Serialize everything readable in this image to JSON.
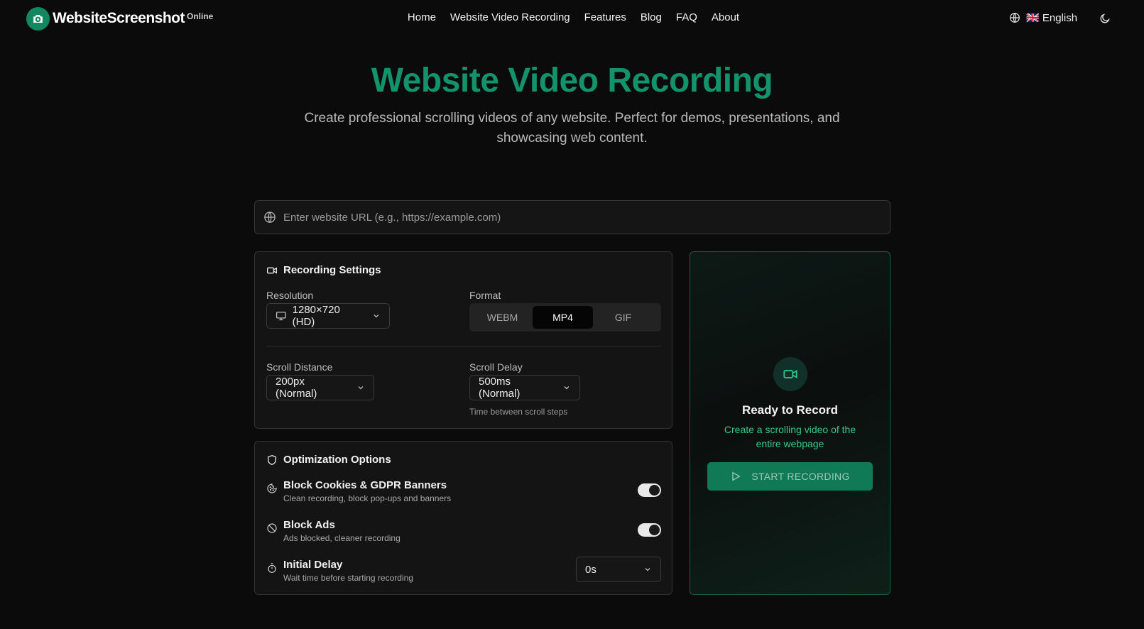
{
  "header": {
    "logo_text": "WebsiteScreenshot",
    "logo_sup": "Online",
    "nav": [
      "Home",
      "Website Video Recording",
      "Features",
      "Blog",
      "FAQ",
      "About"
    ],
    "language": "🇬🇧 English",
    "theme_icon": "moon-icon"
  },
  "hero": {
    "title": "Website Video Recording",
    "subtitle": "Create professional scrolling videos of any website. Perfect for demos, presentations, and showcasing web content."
  },
  "url": {
    "placeholder": "Enter website URL (e.g., https://example.com)",
    "value": ""
  },
  "recording_settings": {
    "title": "Recording Settings",
    "resolution_label": "Resolution",
    "resolution_value": "1280×720 (HD)",
    "format_label": "Format",
    "formats": [
      "WEBM",
      "MP4",
      "GIF"
    ],
    "selected_format": "MP4",
    "scroll_distance_label": "Scroll Distance",
    "scroll_distance_value": "200px (Normal)",
    "scroll_delay_label": "Scroll Delay",
    "scroll_delay_value": "500ms (Normal)",
    "scroll_delay_hint": "Time between scroll steps"
  },
  "optimization": {
    "title": "Optimization Options",
    "options": [
      {
        "title": "Block Cookies & GDPR Banners",
        "desc": "Clean recording, block pop-ups and banners",
        "enabled": true
      },
      {
        "title": "Block Ads",
        "desc": "Ads blocked, cleaner recording",
        "enabled": true
      },
      {
        "title": "Initial Delay",
        "desc": "Wait time before starting recording",
        "value": "0s"
      }
    ]
  },
  "panel": {
    "title": "Ready to Record",
    "subtitle": "Create a scrolling video of the entire webpage",
    "button": "START RECORDING"
  },
  "colors": {
    "accent": "#13936a",
    "button": "#107a56",
    "panel_text": "#35c98b"
  }
}
